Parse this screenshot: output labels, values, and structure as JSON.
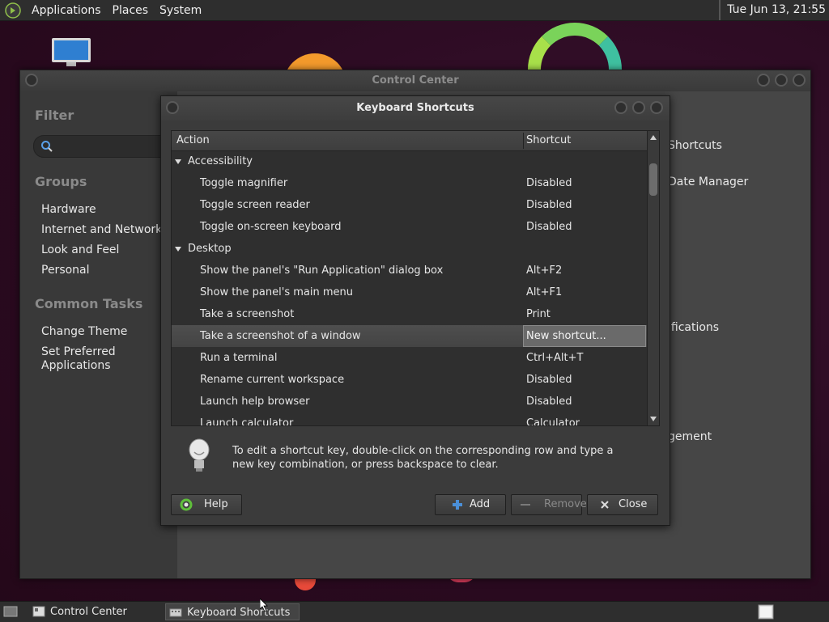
{
  "top_panel": {
    "menus": [
      "Applications",
      "Places",
      "System"
    ],
    "clock": "Tue Jun 13, 21:55"
  },
  "control_center": {
    "title": "Control Center",
    "filter_heading": "Filter",
    "groups_heading": "Groups",
    "groups": [
      "Hardware",
      "Internet and Network",
      "Look and Feel",
      "Personal"
    ],
    "tasks_heading": "Common Tasks",
    "tasks": [
      "Change Theme",
      "Set Preferred",
      "Applications"
    ],
    "partial_items": [
      "Shortcuts",
      "Date Manager",
      "ifications",
      "gement"
    ]
  },
  "dialog": {
    "title": "Keyboard Shortcuts",
    "columns": {
      "action": "Action",
      "shortcut": "Shortcut"
    },
    "rows": [
      {
        "type": "group",
        "action": "Accessibility",
        "shortcut": ""
      },
      {
        "type": "item",
        "action": "Toggle magnifier",
        "shortcut": "Disabled"
      },
      {
        "type": "item",
        "action": "Toggle screen reader",
        "shortcut": "Disabled"
      },
      {
        "type": "item",
        "action": "Toggle on-screen keyboard",
        "shortcut": "Disabled"
      },
      {
        "type": "group",
        "action": "Desktop",
        "shortcut": ""
      },
      {
        "type": "item",
        "action": "Show the panel's \"Run Application\" dialog box",
        "shortcut": "Alt+F2"
      },
      {
        "type": "item",
        "action": "Show the panel's main menu",
        "shortcut": "Alt+F1"
      },
      {
        "type": "item",
        "action": "Take a screenshot",
        "shortcut": "Print"
      },
      {
        "type": "selected",
        "action": "Take a screenshot of a window",
        "shortcut": "New shortcut..."
      },
      {
        "type": "item",
        "action": "Run a terminal",
        "shortcut": "Ctrl+Alt+T"
      },
      {
        "type": "item",
        "action": "Rename current workspace",
        "shortcut": "Disabled"
      },
      {
        "type": "item",
        "action": "Launch help browser",
        "shortcut": "Disabled"
      },
      {
        "type": "item",
        "action": "Launch calculator",
        "shortcut": "Calculator"
      }
    ],
    "info_text": "To edit a shortcut key, double-click on the corresponding row and type a new key combination, or press backspace to clear.",
    "buttons": {
      "help": "Help",
      "add": "Add",
      "remove": "Remove",
      "close": "Close"
    }
  },
  "taskbar": {
    "items": [
      "Control Center",
      "Keyboard Shortcuts"
    ]
  },
  "colors": {
    "panel": "#2e2e2e",
    "accent_add": "#4a8fd8",
    "help_icon": "#5fbf3a"
  }
}
